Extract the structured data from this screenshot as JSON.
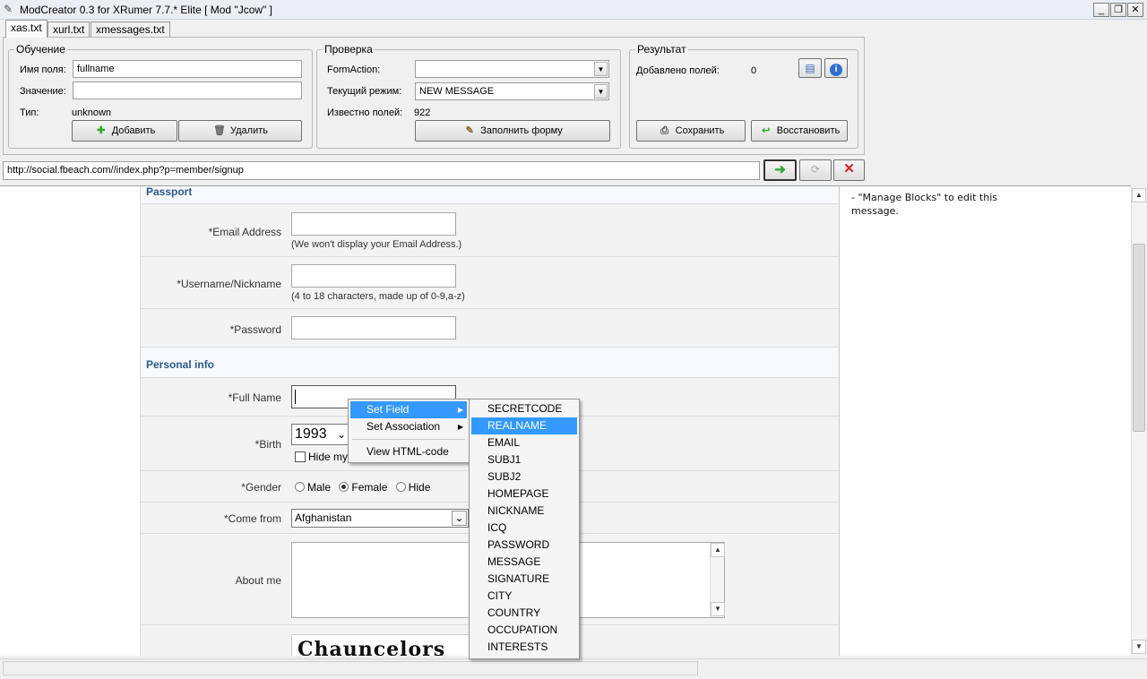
{
  "window": {
    "title": "ModCreator 0.3 for XRumer 7.7.* Elite [ Mod \"Jcow\" ]",
    "minimize": "_",
    "maximize": "❐",
    "close": "✕"
  },
  "tabs": [
    {
      "label": "xas.txt",
      "active": true
    },
    {
      "label": "xurl.txt",
      "active": false
    },
    {
      "label": "xmessages.txt",
      "active": false
    }
  ],
  "learning": {
    "legend": "Обучение",
    "field_name_label": "Имя поля:",
    "field_name_value": "fullname",
    "value_label": "Значение:",
    "value_value": "",
    "type_label": "Тип:",
    "type_value": "unknown",
    "add_button": "Добавить",
    "delete_button": "Удалить"
  },
  "check": {
    "legend": "Проверка",
    "formaction_label": "FormAction:",
    "formaction_value": "",
    "mode_label": "Текущий режим:",
    "mode_value": "NEW MESSAGE",
    "known_label": "Известно полей:",
    "known_value": "922",
    "fill_button": "Заполнить форму"
  },
  "result": {
    "legend": "Результат",
    "added_label": "Добавлено полей:",
    "added_value": "0",
    "save_button": "Сохранить",
    "restore_button": "Восстановить"
  },
  "address": {
    "url": "http://social.fbeach.com//index.php?p=member/signup"
  },
  "form": {
    "passport_title": "Passport",
    "email_label": "*Email Address",
    "email_hint": "(We won't display your Email Address.)",
    "username_label": "*Username/Nickname",
    "username_hint": "(4 to 18 characters, made up of 0-9,a-z)",
    "password_label": "*Password",
    "personal_title": "Personal info",
    "fullname_label": "*Full Name",
    "birth_label": "*Birth",
    "birth_year": "1993",
    "hide_label": "Hide my",
    "gender_label": "*Gender",
    "gender_male": "Male",
    "gender_female": "Female",
    "gender_hide": "Hide",
    "comefrom_label": "*Come from",
    "comefrom_value": "Afghanistan",
    "about_label": "About me",
    "captcha_text": "Chauncelors"
  },
  "right_pane": {
    "text_line1": "- \"Manage Blocks\" to edit this",
    "text_line2": "message."
  },
  "context_menu": {
    "items": [
      "Set Field",
      "Set Association",
      "View HTML-code"
    ]
  },
  "submenu": {
    "items": [
      "SECRETCODE",
      "REALNAME",
      "EMAIL",
      "SUBJ1",
      "SUBJ2",
      "HOMEPAGE",
      "NICKNAME",
      "ICQ",
      "PASSWORD",
      "MESSAGE",
      "SIGNATURE",
      "CITY",
      "COUNTRY",
      "OCCUPATION",
      "INTERESTS"
    ],
    "selected": "REALNAME"
  },
  "colors": {
    "menu_highlight": "#3399ff",
    "section_title": "#2a5a8a",
    "go_arrow": "#2fa82f",
    "stop_x": "#d42020"
  }
}
